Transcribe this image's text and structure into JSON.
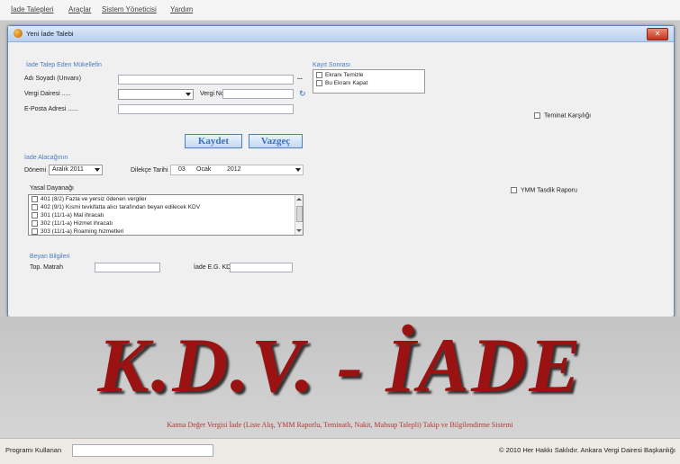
{
  "menu": [
    "İade Talepleri",
    "Araçlar",
    "Sistem Yöneticisi",
    "Yardım"
  ],
  "window": {
    "title": "Yeni İade Talebi",
    "close_glyph": "✕",
    "applicant": {
      "group_label": "İade Talep Eden Mükellefin",
      "name_label": "Adı Soyadı (Unvanı)",
      "name_value": "",
      "browse_label": "...",
      "office_label": "Vergi Dairesi .....",
      "office_value": "",
      "taxno_label": "Vergi No",
      "taxno_value": "",
      "email_label": "E-Posta Adresi ......",
      "email_value": ""
    },
    "buttons": {
      "save": "Kaydet",
      "cancel": "Vazgeç"
    },
    "record": {
      "group_label": "Kayıt Sonrası",
      "options": [
        "Ekranı Temizle",
        "Bu Ekranı Kapat"
      ]
    },
    "refund_period": {
      "group_label": "İade Alacağının",
      "period_label": "Dönemi",
      "period_value": "Aralık 2011",
      "petition_label": "Dilekçe Tarihi",
      "day": "03",
      "month": "Ocak",
      "year": "2012"
    },
    "legal": {
      "label": "Yasal Dayanağı",
      "items": [
        "401 (8/2) Fazla ve yersiz ödenen vergiler",
        "402 (9/1) Kısmi tevkifatta alıcı tarafından beyan edilecek KDV",
        "301 (11/1-a) Mal ihracatı",
        "302 (11/1-a) Hizmet ihracatı",
        "303 (11/1-a) Roaming hizmetleri"
      ]
    },
    "declaration": {
      "group_label": "Beyan Bilgileri",
      "matrah_label": "Top. Matrah",
      "matrah_value": "",
      "kdv_label": "İade E.G. KDV",
      "kdv_value": ""
    },
    "checks": {
      "guarantee": "Teminat Karşılığı",
      "ymm": "YMM Tasdik Raporu"
    }
  },
  "banner": {
    "title": "K.D.V. - İADE",
    "subtitle": "Katma Değer Vergisi İade (Liste Alış, YMM Raporlu, Teminatlı, Nakit, Mahsup Talepli) Takip ve Bilgilendirme Sistemi"
  },
  "status": {
    "user_label": "Programı Kullanan",
    "user_value": "",
    "copyright": "© 2010 Her Hakkı Saklıdır. Ankara Vergi Dairesi Başkanlığı"
  },
  "colors": {
    "accent": "#4a7bc0",
    "banner_text": "#9b1212",
    "window_border": "#5a86b8"
  }
}
